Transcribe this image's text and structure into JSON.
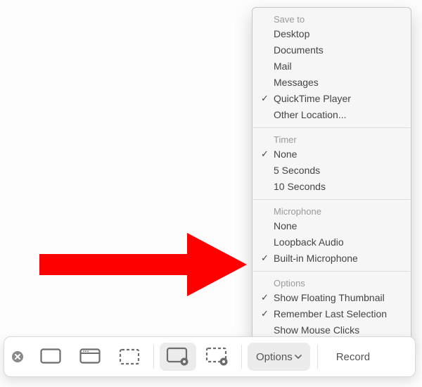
{
  "menu": {
    "sections": [
      {
        "title": "Save to",
        "items": [
          {
            "label": "Desktop",
            "checked": false
          },
          {
            "label": "Documents",
            "checked": false
          },
          {
            "label": "Mail",
            "checked": false
          },
          {
            "label": "Messages",
            "checked": false
          },
          {
            "label": "QuickTime Player",
            "checked": true
          },
          {
            "label": "Other Location...",
            "checked": false
          }
        ]
      },
      {
        "title": "Timer",
        "items": [
          {
            "label": "None",
            "checked": true
          },
          {
            "label": "5 Seconds",
            "checked": false
          },
          {
            "label": "10 Seconds",
            "checked": false
          }
        ]
      },
      {
        "title": "Microphone",
        "items": [
          {
            "label": "None",
            "checked": false
          },
          {
            "label": "Loopback Audio",
            "checked": false
          },
          {
            "label": "Built-in Microphone",
            "checked": true
          }
        ]
      },
      {
        "title": "Options",
        "items": [
          {
            "label": "Show Floating Thumbnail",
            "checked": true
          },
          {
            "label": "Remember Last Selection",
            "checked": true
          },
          {
            "label": "Show Mouse Clicks",
            "checked": false
          }
        ]
      }
    ]
  },
  "toolbar": {
    "options_label": "Options",
    "record_label": "Record",
    "buttons": [
      {
        "name": "capture-entire-screen",
        "selected": false
      },
      {
        "name": "capture-window",
        "selected": false
      },
      {
        "name": "capture-selection",
        "selected": false
      },
      {
        "name": "record-entire-screen",
        "selected": true
      },
      {
        "name": "record-selection",
        "selected": false
      }
    ]
  },
  "annotation": {
    "arrow_color": "#ff0000"
  }
}
